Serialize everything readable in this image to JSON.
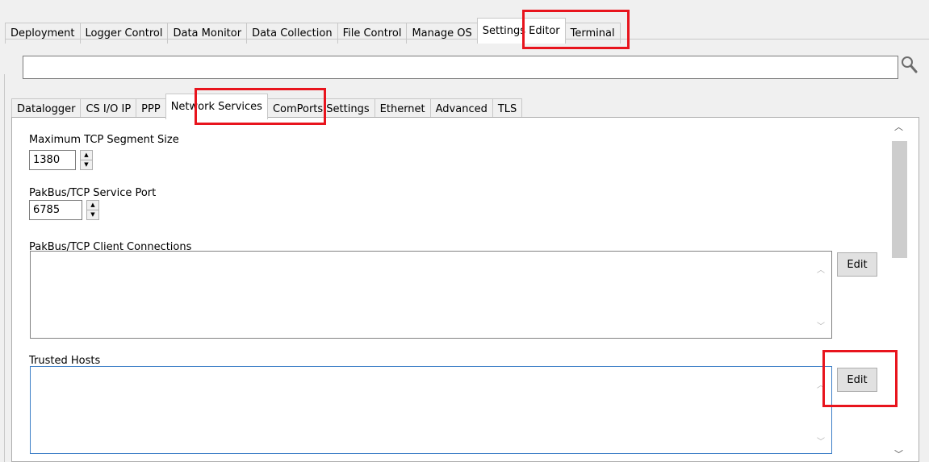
{
  "main_tabs": [
    "Deployment",
    "Logger Control",
    "Data Monitor",
    "Data Collection",
    "File Control",
    "Manage OS",
    "Settings Editor",
    "Terminal"
  ],
  "main_active": "Settings Editor",
  "search": {
    "value": "",
    "icon": "magnifier-icon"
  },
  "sub_tabs": [
    "Datalogger",
    "CS I/O IP",
    "PPP",
    "Network Services",
    "ComPorts Settings",
    "Ethernet",
    "Advanced",
    "TLS"
  ],
  "sub_active": "Network Services",
  "fields": {
    "tcp_segment": {
      "label": "Maximum TCP Segment Size",
      "value": "1380"
    },
    "pakbus_port": {
      "label": "PakBus/TCP Service Port",
      "value": "6785"
    },
    "client_conn": {
      "label": "PakBus/TCP Client Connections",
      "button": "Edit"
    },
    "trusted_hosts": {
      "label": "Trusted Hosts",
      "button": "Edit"
    }
  },
  "highlight_color": "#e8141d"
}
